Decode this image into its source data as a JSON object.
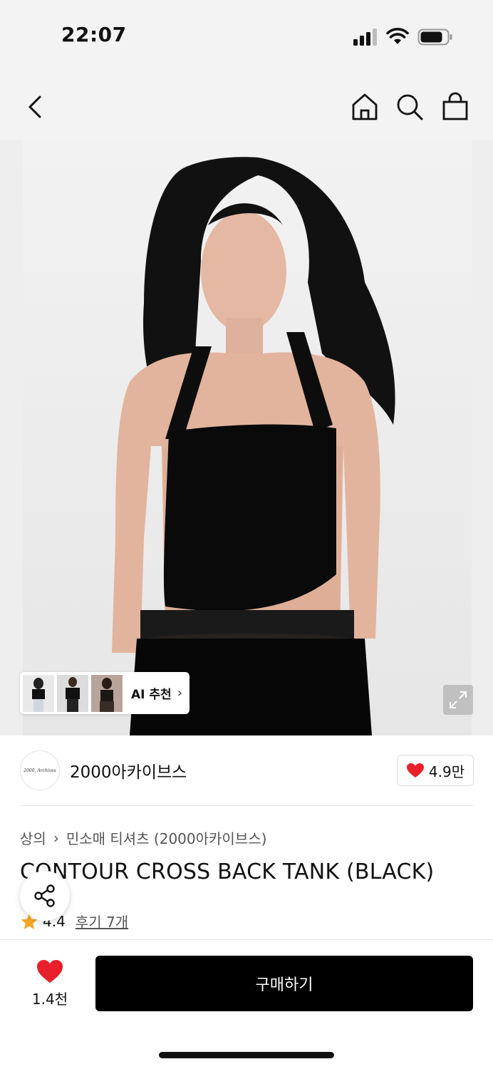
{
  "status_bar": {
    "time": "22:07"
  },
  "nav": {
    "icons": [
      "back-arrow-icon",
      "home-icon",
      "search-icon",
      "shopping-bag-icon"
    ]
  },
  "product_image": {
    "ai_recommend_label": "AI 추천",
    "ai_recommend_chevron": "›"
  },
  "seller": {
    "logo_text": "2000, Archives",
    "name": "2000아카이브스",
    "like_count": "4.9만"
  },
  "breadcrumb": {
    "category": "상의",
    "separator": "›",
    "subcategory": "민소매 티셔츠 (2000아카이브스)"
  },
  "product": {
    "title": "CONTOUR CROSS BACK TANK (BLACK)",
    "rating": "4.4",
    "reviews": "후기 7개"
  },
  "bottom_bar": {
    "wish_count": "1.4천",
    "buy_label": "구매하기"
  },
  "colors": {
    "accent_red": "#e8202a",
    "star": "#f5a623",
    "button": "#000000"
  }
}
